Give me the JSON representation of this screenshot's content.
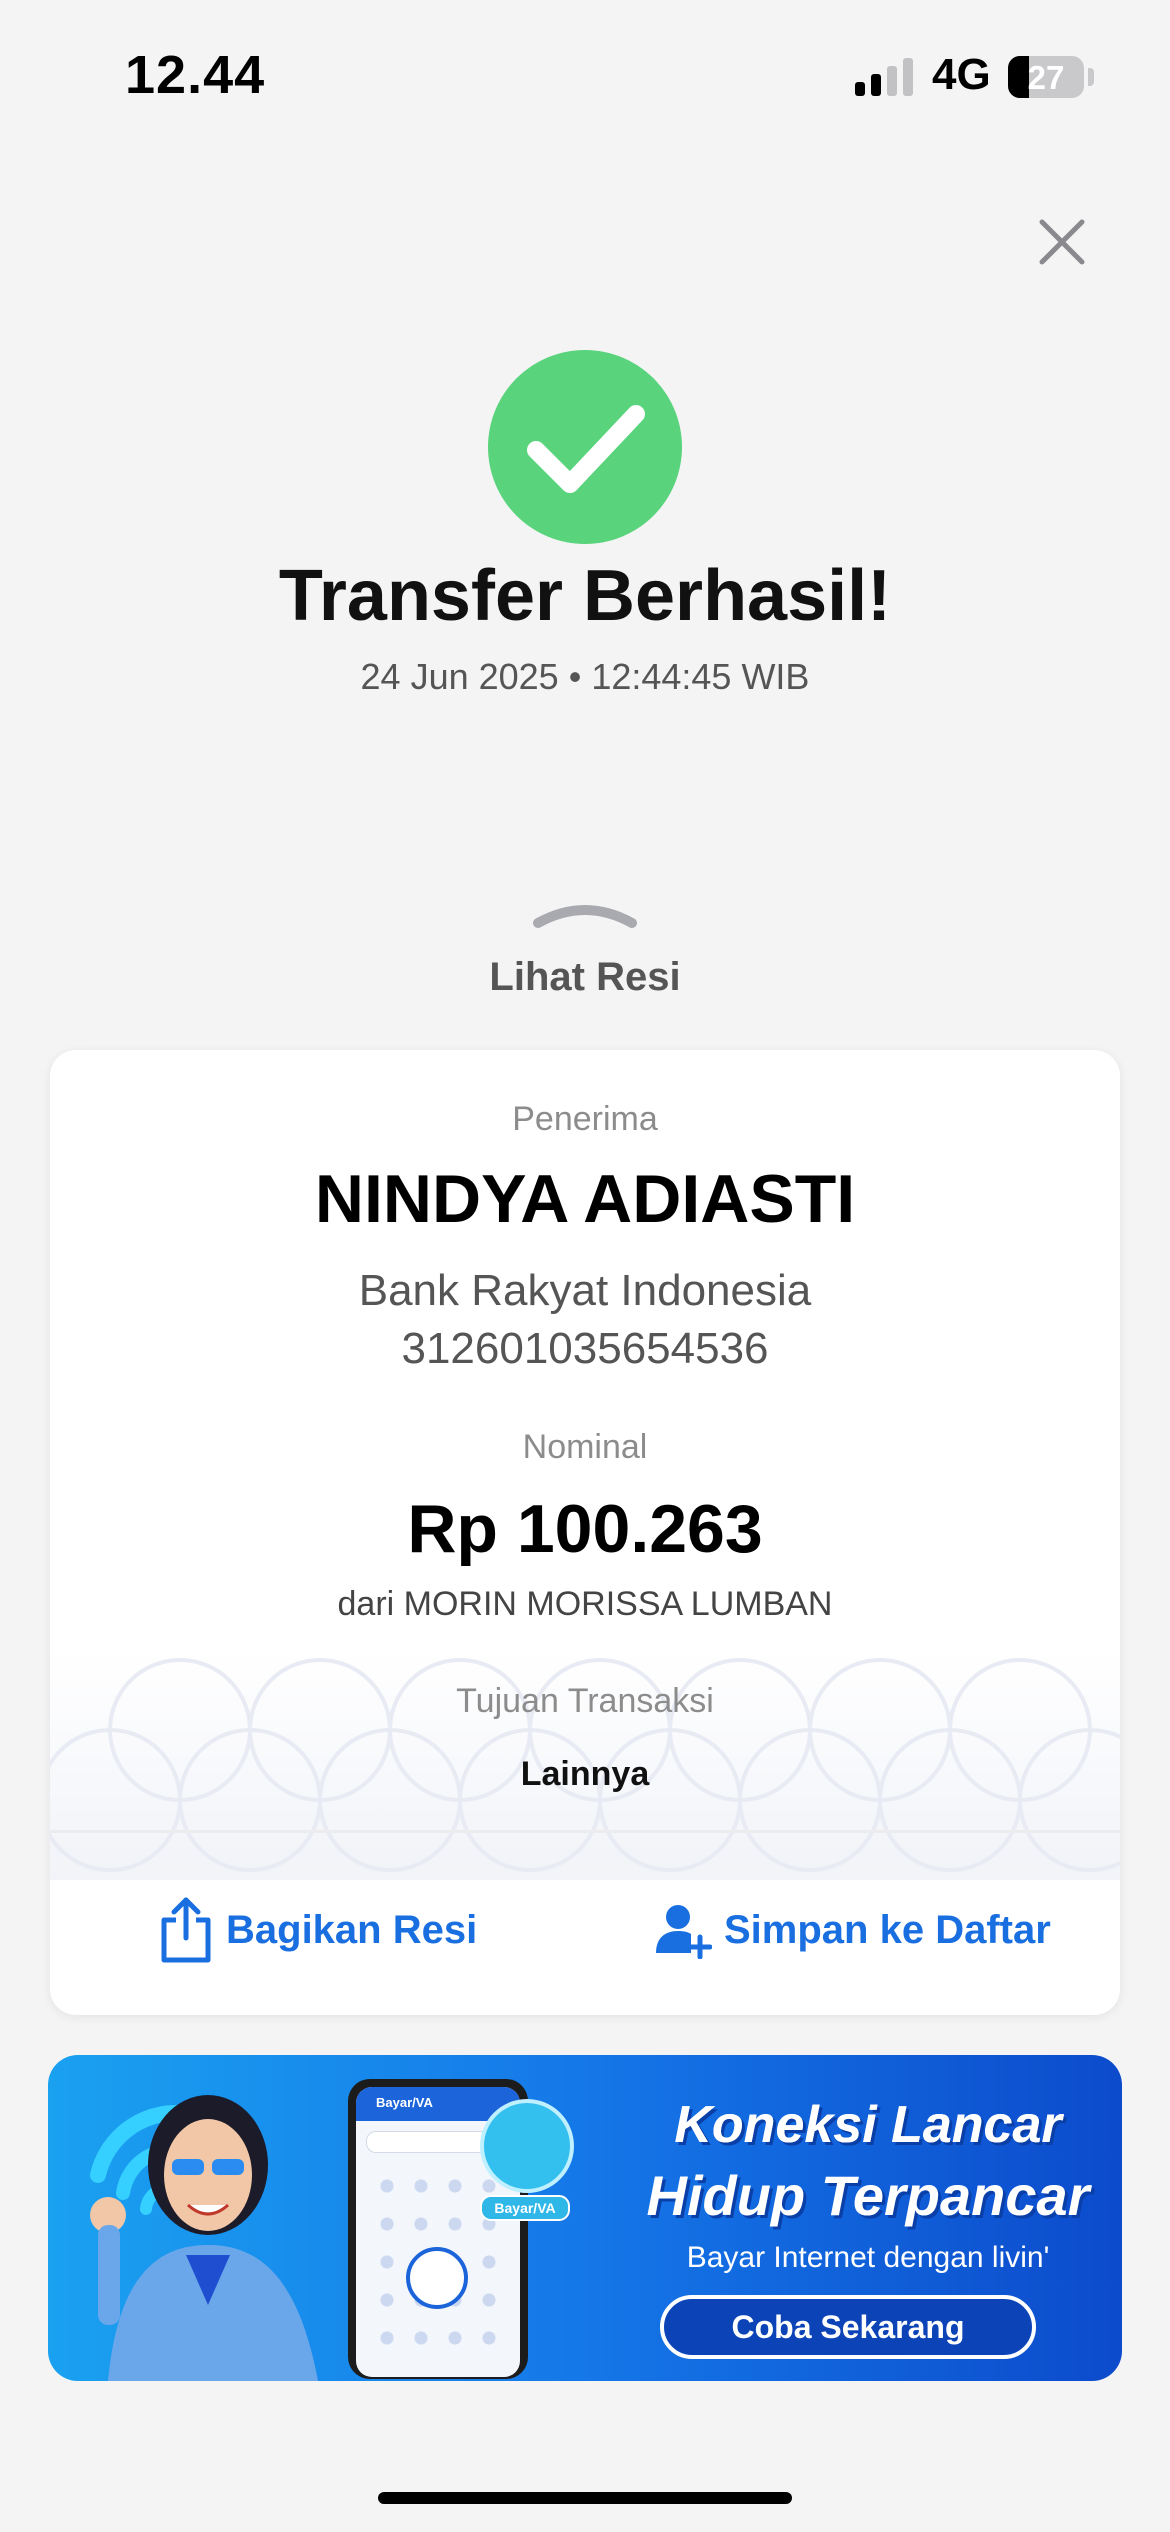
{
  "status_bar": {
    "time": "12.44",
    "network": "4G",
    "battery": "27",
    "battery_level": 0.27
  },
  "header": {
    "title": "Transfer Berhasil!",
    "datetime": "24 Jun 2025 • 12:44:45 WIB"
  },
  "receipt_toggle": {
    "label": "Lihat Resi"
  },
  "card": {
    "recipient_label": "Penerima",
    "recipient_name": "NINDYA ADIASTI",
    "bank_name": "Bank Rakyat Indonesia",
    "account_number": "312601035654536",
    "amount_label": "Nominal",
    "amount": "Rp 100.263",
    "sender": "dari MORIN MORISSA LUMBAN",
    "purpose_label": "Tujuan Transaksi",
    "purpose_value": "Lainnya",
    "share_label": "Bagikan Resi",
    "save_label": "Simpan ke Daftar"
  },
  "banner": {
    "line1": "Koneksi Lancar",
    "line2": "Hidup Terpancar",
    "subtitle": "Bayar Internet dengan livin'",
    "cta": "Coba Sekarang",
    "badge": "Bayar/VA",
    "phone_header": "Bayar/VA"
  },
  "colors": {
    "success": "#5ad47c",
    "action": "#1a6fe0",
    "background": "#f4f4f5"
  },
  "icons": [
    "close-icon",
    "check-icon",
    "chevron-up-icon",
    "share-icon",
    "add-contact-icon",
    "wifi-icon"
  ]
}
